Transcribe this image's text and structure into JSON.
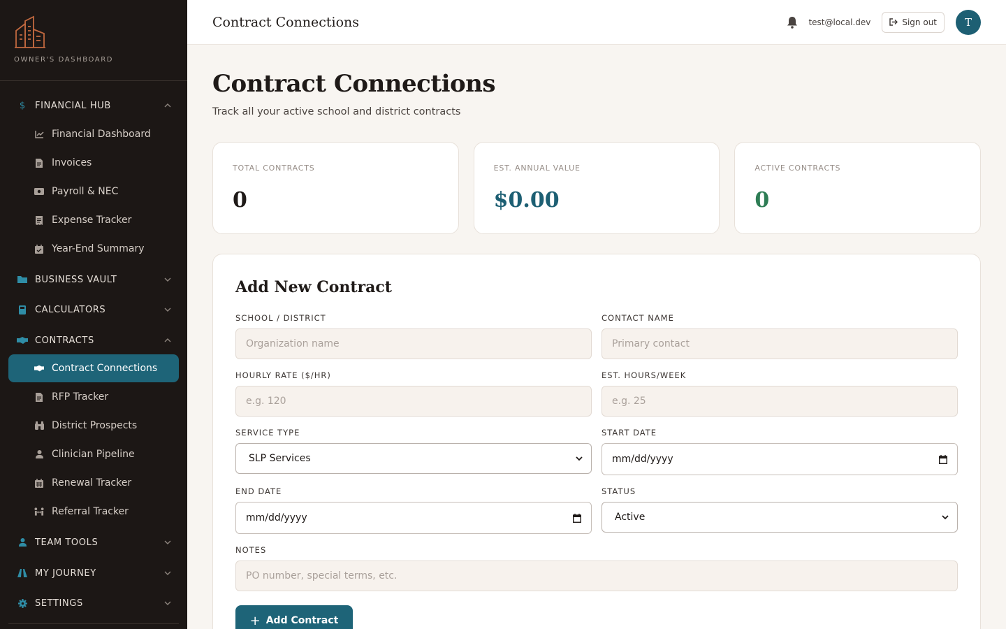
{
  "brand": {
    "label": "OWNER'S DASHBOARD"
  },
  "sidebar": {
    "sections": [
      {
        "label": "FINANCIAL HUB",
        "icon": "dollar-icon",
        "expanded": true
      },
      {
        "label": "BUSINESS VAULT",
        "icon": "folder-icon",
        "expanded": false
      },
      {
        "label": "CALCULATORS",
        "icon": "calculator-icon",
        "expanded": false
      },
      {
        "label": "CONTRACTS",
        "icon": "handshake-icon",
        "expanded": true
      },
      {
        "label": "TEAM TOOLS",
        "icon": "user-icon",
        "expanded": false
      },
      {
        "label": "MY JOURNEY",
        "icon": "route-icon",
        "expanded": false
      },
      {
        "label": "SETTINGS",
        "icon": "gear-icon",
        "expanded": false
      }
    ],
    "financial_items": [
      {
        "label": "Financial Dashboard",
        "icon": "chart-icon"
      },
      {
        "label": "Invoices",
        "icon": "file-icon"
      },
      {
        "label": "Payroll & NEC",
        "icon": "money-icon"
      },
      {
        "label": "Expense Tracker",
        "icon": "receipt-icon"
      },
      {
        "label": "Year-End Summary",
        "icon": "calendar-check-icon"
      }
    ],
    "contract_items": [
      {
        "label": "Contract Connections",
        "icon": "handshake-icon",
        "active": true
      },
      {
        "label": "RFP Tracker",
        "icon": "file-icon"
      },
      {
        "label": "District Prospects",
        "icon": "binoculars-icon"
      },
      {
        "label": "Clinician Pipeline",
        "icon": "user-icon"
      },
      {
        "label": "Renewal Tracker",
        "icon": "calendar-icon"
      },
      {
        "label": "Referral Tracker",
        "icon": "people-arrows-icon"
      }
    ]
  },
  "header": {
    "title": "Contract Connections",
    "email": "test@local.dev",
    "signout_label": "Sign out",
    "avatar_initial": "T"
  },
  "page": {
    "title": "Contract Connections",
    "subtitle": "Track all your active school and district contracts"
  },
  "stats": [
    {
      "label": "TOTAL CONTRACTS",
      "value": "0",
      "color": "#1f1a18"
    },
    {
      "label": "EST. ANNUAL VALUE",
      "value": "$0.00",
      "color": "#1d5f73"
    },
    {
      "label": "ACTIVE CONTRACTS",
      "value": "0",
      "color": "#2e7d55"
    }
  ],
  "form": {
    "title": "Add New Contract",
    "school_label": "SCHOOL / DISTRICT",
    "school_placeholder": "Organization name",
    "contact_label": "CONTACT NAME",
    "contact_placeholder": "Primary contact",
    "rate_label": "HOURLY RATE ($/HR)",
    "rate_placeholder": "e.g. 120",
    "hours_label": "EST. HOURS/WEEK",
    "hours_placeholder": "e.g. 25",
    "service_label": "SERVICE TYPE",
    "service_value": "SLP Services",
    "start_label": "START DATE",
    "start_value": "mm/dd/yyyy",
    "end_label": "END DATE",
    "end_value": "mm/dd/yyyy",
    "status_label": "STATUS",
    "status_value": "Active",
    "notes_label": "NOTES",
    "notes_placeholder": "PO number, special terms, etc.",
    "submit_label": "Add Contract"
  },
  "colors": {
    "accent": "#1e6478",
    "sidebar_bg": "#1c1715",
    "brand_logo": "#c0683f",
    "page_bg": "#f8f5f1"
  }
}
